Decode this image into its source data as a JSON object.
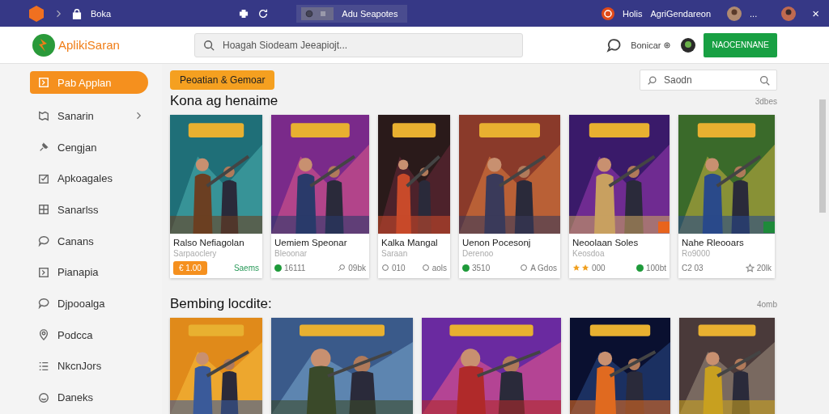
{
  "top_bar": {
    "breadcrumb": "Boka",
    "tab": {
      "label": "Adu Seapotes"
    },
    "account": {
      "name": "Holis",
      "org": "AgriGendareon"
    },
    "more": "...",
    "close": "×"
  },
  "header": {
    "logo": "AplikiSaran",
    "search": {
      "placeholder": "Hoagah Siodeam Jeeapiojt..."
    },
    "user_label": "Bonicar",
    "action_button": "NAOCENNANE"
  },
  "sidebar": {
    "items": [
      {
        "label": "Pab Applan",
        "selected": true
      },
      {
        "label": "Sanarin",
        "selected": false,
        "has_chevron": true
      },
      {
        "label": "Cengjan",
        "selected": false
      },
      {
        "label": "Apkoagales",
        "selected": false
      },
      {
        "label": "Sanarlss",
        "selected": false
      },
      {
        "label": "Canans",
        "selected": false
      },
      {
        "label": "Pianapia",
        "selected": false
      },
      {
        "label": "Djpooalga",
        "selected": false
      },
      {
        "label": "Podcca",
        "selected": false
      },
      {
        "label": "NkcnJors",
        "selected": false
      },
      {
        "label": "Daneks",
        "selected": false
      }
    ]
  },
  "filter_chip": "Peoatian & Gemoar",
  "search": {
    "placeholder": "Saodn"
  },
  "sections": [
    {
      "title": "Kona ag henaime",
      "more": "3dbes",
      "cards": [
        {
          "kind": "game",
          "title": "Ralso Nefiagolan",
          "subtitle": "Sarpaoclery",
          "left": {
            "kind": "badge",
            "text": "€ 1.00"
          },
          "right": {
            "kind": "accent",
            "text": "Saems"
          }
        },
        {
          "kind": "game",
          "title": "Uemiem Speonar",
          "subtitle": "Bleoonar",
          "left": {
            "kind": "dot",
            "text": "16111"
          },
          "right": {
            "kind": "chat",
            "text": "09bk"
          }
        },
        {
          "kind": "game",
          "title": "Kalka Mangal",
          "subtitle": "Saraan",
          "left": {
            "kind": "ring",
            "text": "010"
          },
          "right": {
            "kind": "ring",
            "text": "aols"
          }
        },
        {
          "kind": "game",
          "title": "Uenon Pocesonj",
          "subtitle": "Derenoo",
          "left": {
            "kind": "dot",
            "text": "3510"
          },
          "right": {
            "kind": "ring",
            "text": "A Gdos"
          }
        },
        {
          "kind": "game",
          "title": "Neoolaan Soles",
          "subtitle": "Keosdoa",
          "corner_tag": {
            "color": "#e8641c"
          },
          "left": {
            "kind": "stars",
            "text": "000"
          },
          "right": {
            "kind": "dot",
            "text": "100bt"
          }
        },
        {
          "kind": "game",
          "title": "Nahe Rleooars",
          "subtitle": "Ro9000",
          "corner_tag": {
            "color": "#1e8a3a"
          },
          "left": {
            "kind": "plain",
            "text": "C2 03"
          },
          "right": {
            "kind": "star",
            "text": "20lk"
          }
        }
      ]
    },
    {
      "title": "Bembing locdite:",
      "more": "4omb"
    }
  ]
}
